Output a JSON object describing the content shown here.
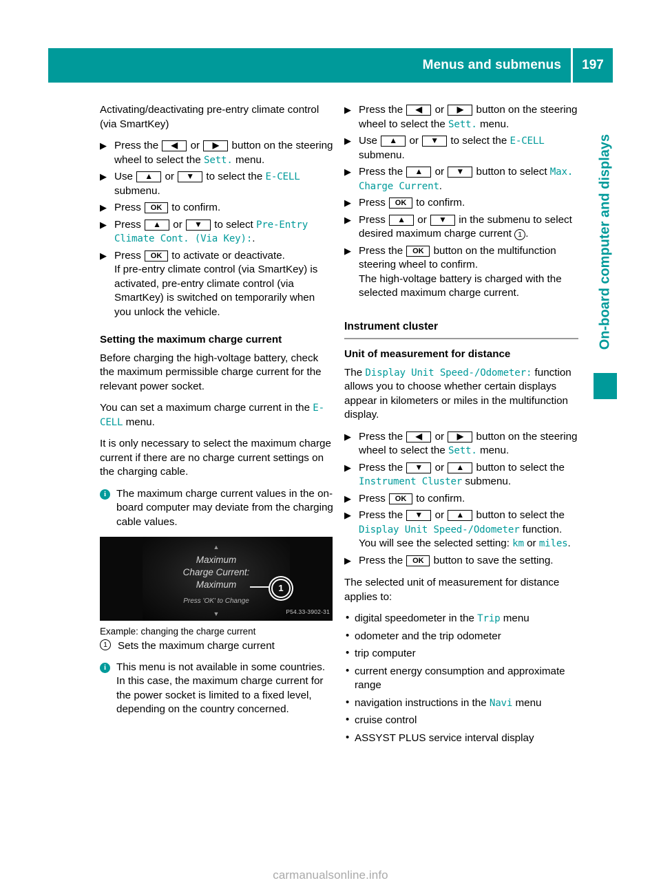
{
  "header": {
    "title": "Menus and submenus",
    "page_number": "197",
    "accent_color": "#009a9a"
  },
  "side_tab": {
    "label": "On-board computer and displays",
    "color": "#009a9a"
  },
  "keys": {
    "left": "◀",
    "right": "▶",
    "up": "▲",
    "down": "▼",
    "ok": "OK"
  },
  "markers": {
    "step": "▶",
    "bullet": "•",
    "info": "i",
    "one": "1"
  },
  "left_column": {
    "intro_heading": "Activating/deactivating pre-entry climate control (via SmartKey)",
    "steps": [
      {
        "parts": [
          {
            "t": "text",
            "v": "Press the "
          },
          {
            "t": "key",
            "v": "left"
          },
          {
            "t": "text",
            "v": " or "
          },
          {
            "t": "key",
            "v": "right"
          },
          {
            "t": "text",
            "v": " button on the steering wheel to select the "
          },
          {
            "t": "mono",
            "v": "Sett."
          },
          {
            "t": "text",
            "v": " menu."
          }
        ]
      },
      {
        "parts": [
          {
            "t": "text",
            "v": "Use "
          },
          {
            "t": "key",
            "v": "up"
          },
          {
            "t": "text",
            "v": " or "
          },
          {
            "t": "key",
            "v": "down"
          },
          {
            "t": "text",
            "v": " to select the "
          },
          {
            "t": "mono",
            "v": "E-CELL"
          },
          {
            "t": "text",
            "v": " submenu."
          }
        ]
      },
      {
        "parts": [
          {
            "t": "text",
            "v": "Press "
          },
          {
            "t": "key",
            "v": "ok"
          },
          {
            "t": "text",
            "v": " to confirm."
          }
        ]
      },
      {
        "parts": [
          {
            "t": "text",
            "v": "Press "
          },
          {
            "t": "key",
            "v": "up"
          },
          {
            "t": "text",
            "v": " or "
          },
          {
            "t": "key",
            "v": "down"
          },
          {
            "t": "text",
            "v": " to select "
          },
          {
            "t": "mono",
            "v": "Pre-Entry Climate Cont. (Via Key):"
          },
          {
            "t": "text",
            "v": "."
          }
        ]
      },
      {
        "parts": [
          {
            "t": "text",
            "v": "Press "
          },
          {
            "t": "key",
            "v": "ok"
          },
          {
            "t": "text",
            "v": " to activate or deactivate."
          }
        ],
        "sub": "If pre-entry climate control (via SmartKey) is activated, pre-entry climate control (via SmartKey) is switched on temporarily when you unlock the vehicle."
      }
    ],
    "section_heading": "Setting the maximum charge current",
    "para_1": "Before charging the high-voltage battery, check the maximum permissible charge current for the relevant power socket.",
    "para_2_a": "You can set a maximum charge current in the ",
    "para_2_mono": "E-CELL",
    "para_2_b": " menu.",
    "para_3": "It is only necessary to select the maximum charge current if there are no charge current settings on the charging cable.",
    "note_1": "The maximum charge current values in the on-board computer may deviate from the charging cable values.",
    "figure": {
      "line_1": "Maximum",
      "line_2": "Charge Current:",
      "line_3": "Maximum",
      "line_4": "Press 'OK' to Change",
      "arrow_up": "▲",
      "arrow_down": "▼",
      "callout": "1",
      "watermark": "P54.33-3902-31"
    },
    "figure_caption": "Example: changing the charge current",
    "legend_1": "Sets the maximum charge current",
    "note_2": "This menu is not available in some countries. In this case, the maximum charge current for the power socket is limited to a fixed level, depending on the country concerned."
  },
  "right_column": {
    "steps_top": [
      {
        "parts": [
          {
            "t": "text",
            "v": "Press the "
          },
          {
            "t": "key",
            "v": "left"
          },
          {
            "t": "text",
            "v": " or "
          },
          {
            "t": "key",
            "v": "right"
          },
          {
            "t": "text",
            "v": " button on the steering wheel to select the "
          },
          {
            "t": "mono",
            "v": "Sett."
          },
          {
            "t": "text",
            "v": " menu."
          }
        ]
      },
      {
        "parts": [
          {
            "t": "text",
            "v": "Use "
          },
          {
            "t": "key",
            "v": "up"
          },
          {
            "t": "text",
            "v": " or "
          },
          {
            "t": "key",
            "v": "down"
          },
          {
            "t": "text",
            "v": " to select the "
          },
          {
            "t": "mono",
            "v": "E-CELL"
          },
          {
            "t": "text",
            "v": " submenu."
          }
        ]
      },
      {
        "parts": [
          {
            "t": "text",
            "v": "Press the "
          },
          {
            "t": "key",
            "v": "up"
          },
          {
            "t": "text",
            "v": " or "
          },
          {
            "t": "key",
            "v": "down"
          },
          {
            "t": "text",
            "v": " button to select "
          },
          {
            "t": "mono",
            "v": "Max. Charge Current"
          },
          {
            "t": "text",
            "v": "."
          }
        ]
      },
      {
        "parts": [
          {
            "t": "text",
            "v": "Press "
          },
          {
            "t": "key",
            "v": "ok"
          },
          {
            "t": "text",
            "v": " to confirm."
          }
        ]
      },
      {
        "parts": [
          {
            "t": "text",
            "v": "Press "
          },
          {
            "t": "key",
            "v": "up"
          },
          {
            "t": "text",
            "v": " or "
          },
          {
            "t": "key",
            "v": "down"
          },
          {
            "t": "text",
            "v": " in the submenu to select desired maximum charge current "
          },
          {
            "t": "circled",
            "v": "1"
          },
          {
            "t": "text",
            "v": "."
          }
        ]
      },
      {
        "parts": [
          {
            "t": "text",
            "v": "Press the "
          },
          {
            "t": "key",
            "v": "ok"
          },
          {
            "t": "text",
            "v": " button on the multifunction steering wheel to confirm."
          }
        ],
        "sub": "The high-voltage battery is charged with the selected maximum charge current."
      }
    ],
    "section_heading": "Instrument cluster",
    "sub_heading": "Unit of measurement for distance",
    "intro_a": "The ",
    "intro_mono": "Display Unit Speed-/Odometer:",
    "intro_b": " function allows you to choose whether certain displays appear in kilometers or miles in the multifunction display.",
    "steps_bottom": [
      {
        "parts": [
          {
            "t": "text",
            "v": "Press the "
          },
          {
            "t": "key",
            "v": "left"
          },
          {
            "t": "text",
            "v": " or "
          },
          {
            "t": "key",
            "v": "right"
          },
          {
            "t": "text",
            "v": " button on the steering wheel to select the "
          },
          {
            "t": "mono",
            "v": "Sett."
          },
          {
            "t": "text",
            "v": " menu."
          }
        ]
      },
      {
        "parts": [
          {
            "t": "text",
            "v": "Press the "
          },
          {
            "t": "key",
            "v": "down"
          },
          {
            "t": "text",
            "v": " or "
          },
          {
            "t": "key",
            "v": "up"
          },
          {
            "t": "text",
            "v": " button to select the "
          },
          {
            "t": "mono",
            "v": "Instrument Cluster"
          },
          {
            "t": "text",
            "v": " submenu."
          }
        ]
      },
      {
        "parts": [
          {
            "t": "text",
            "v": "Press "
          },
          {
            "t": "key",
            "v": "ok"
          },
          {
            "t": "text",
            "v": " to confirm."
          }
        ]
      },
      {
        "parts": [
          {
            "t": "text",
            "v": "Press the "
          },
          {
            "t": "key",
            "v": "down"
          },
          {
            "t": "text",
            "v": " or "
          },
          {
            "t": "key",
            "v": "up"
          },
          {
            "t": "text",
            "v": " button to select the "
          },
          {
            "t": "mono",
            "v": "Display Unit Speed-/Odometer"
          },
          {
            "t": "text",
            "v": " function."
          }
        ],
        "sub_parts": [
          {
            "t": "text",
            "v": "You will see the selected setting: "
          },
          {
            "t": "mono",
            "v": "km"
          },
          {
            "t": "text",
            "v": " or "
          },
          {
            "t": "mono",
            "v": "miles"
          },
          {
            "t": "text",
            "v": "."
          }
        ]
      },
      {
        "parts": [
          {
            "t": "text",
            "v": "Press the "
          },
          {
            "t": "key",
            "v": "ok"
          },
          {
            "t": "text",
            "v": " button to save the setting."
          }
        ]
      }
    ],
    "applies_para": "The selected unit of measurement for distance applies to:",
    "bullets": [
      {
        "parts": [
          {
            "t": "text",
            "v": "digital speedometer in the "
          },
          {
            "t": "mono",
            "v": "Trip"
          },
          {
            "t": "text",
            "v": " menu"
          }
        ]
      },
      {
        "parts": [
          {
            "t": "text",
            "v": "odometer and the trip odometer"
          }
        ]
      },
      {
        "parts": [
          {
            "t": "text",
            "v": "trip computer"
          }
        ]
      },
      {
        "parts": [
          {
            "t": "text",
            "v": "current energy consumption and approximate range"
          }
        ]
      },
      {
        "parts": [
          {
            "t": "text",
            "v": "navigation instructions in the "
          },
          {
            "t": "mono",
            "v": "Navi"
          },
          {
            "t": "text",
            "v": " menu"
          }
        ]
      },
      {
        "parts": [
          {
            "t": "text",
            "v": "cruise control"
          }
        ]
      },
      {
        "parts": [
          {
            "t": "text",
            "v": "ASSYST PLUS service interval display"
          }
        ]
      }
    ]
  },
  "footer": {
    "watermark": "carmanualsonline.info"
  }
}
